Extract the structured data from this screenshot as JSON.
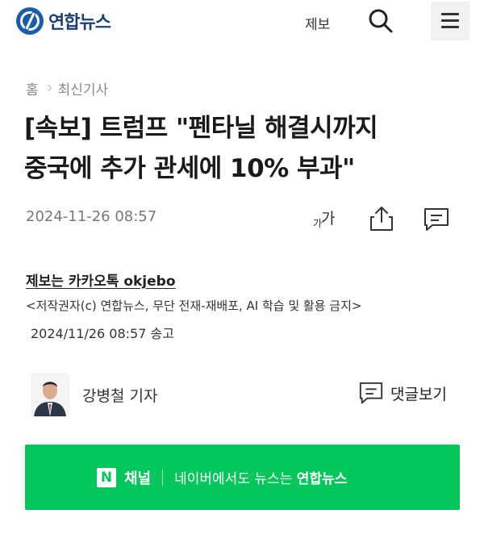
{
  "header": {
    "logo_text": "연합뉴스",
    "tip_label": "제보",
    "search_icon": "search-icon",
    "menu_icon": "hamburger-menu-icon"
  },
  "breadcrumb": {
    "home": "홈",
    "section": "최신기사"
  },
  "article": {
    "title_line1": "[속보] 트럼프 \"펜타닐 해결시까지",
    "title_line2": "중국에 추가 관세에 10% 부과\"",
    "date": "2024-11-26 08:57",
    "font_small": "가",
    "font_large": "가",
    "tip_info": "제보는 카카오톡 okjebo",
    "copyright": "<저작권자(c) 연합뉴스, 무단 전재-재배포, AI 학습 및 활용 금지>",
    "sent_time": "2024/11/26 08:57 송고"
  },
  "reporter": {
    "name": "강병철 기자",
    "comment_view_label": "댓글보기"
  },
  "naver_banner": {
    "n_letter": "N",
    "channel_label": "채널",
    "text_prefix": "네이버에서도 뉴스는",
    "text_brand": "연합뉴스"
  },
  "colors": {
    "brand_blue": "#1c5ba8",
    "naver_green": "#03c75a"
  }
}
